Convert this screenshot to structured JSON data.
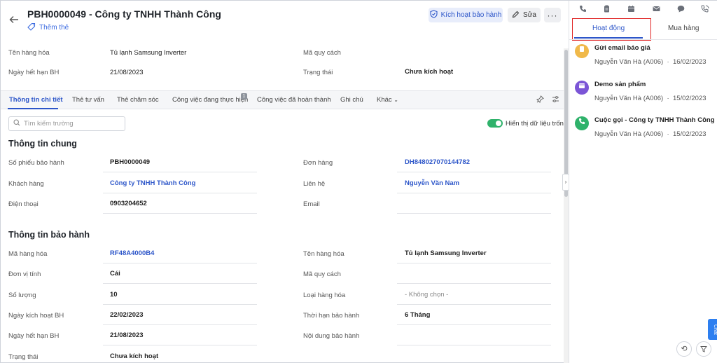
{
  "header": {
    "title": "PBH0000049 - Công ty TNHH Thành Công",
    "add_tag": "Thêm thẻ",
    "activate_btn": "Kích hoạt bảo hành",
    "edit_btn": "Sửa",
    "more_btn": "···"
  },
  "top_fields": {
    "product_name_label": "Tên hàng hóa",
    "product_name_value": "Tủ lạnh Samsung Inverter",
    "spec_label": "Mã quy cách",
    "expiry_label": "Ngày hết hạn BH",
    "expiry_value": "21/08/2023",
    "status_label": "Trạng thái",
    "status_value": "Chưa kích hoạt"
  },
  "tabs": [
    {
      "label": "Thông tin chi tiết"
    },
    {
      "label": "Thẻ tư vấn"
    },
    {
      "label": "Thẻ chăm sóc"
    },
    {
      "label": "Công việc đang thực hiện",
      "badge": "1"
    },
    {
      "label": "Công việc đã hoàn thành"
    },
    {
      "label": "Ghi chú"
    },
    {
      "label": "Khác"
    }
  ],
  "search": {
    "placeholder": "Tìm kiếm trường"
  },
  "toggle_label": "Hiển thị dữ liệu trống",
  "general": {
    "title": "Thông tin chung",
    "rows": [
      {
        "l1": "Số phiếu bảo hành",
        "v1": "PBH0000049",
        "l2": "Đơn hàng",
        "v2": "DH848027070144782"
      },
      {
        "l1": "Khách hàng",
        "v1": "Công ty TNHH Thành Công",
        "l2": "Liên hệ",
        "v2": "Nguyễn Văn Nam"
      },
      {
        "l1": "Điện thoại",
        "v1": "0903204652",
        "l2": "Email",
        "v2": ""
      }
    ]
  },
  "warranty": {
    "title": "Thông tin bảo hành",
    "rows": [
      {
        "l1": "Mã hàng hóa",
        "v1": "RF48A4000B4",
        "l2": "Tên hàng hóa",
        "v2": "Tủ lạnh Samsung Inverter"
      },
      {
        "l1": "Đơn vị tính",
        "v1": "Cái",
        "l2": "Mã quy cách",
        "v2": ""
      },
      {
        "l1": "Số lượng",
        "v1": "10",
        "l2": "Loại hàng hóa",
        "v2": "- Không chọn -"
      },
      {
        "l1": "Ngày kích hoạt BH",
        "v1": "22/02/2023",
        "l2": "Thời hạn bảo hành",
        "v2": "6 Tháng"
      },
      {
        "l1": "Ngày hết hạn BH",
        "v1": "21/08/2023",
        "l2": "Nội dung bảo hành",
        "v2": ""
      },
      {
        "l1": "Trạng thái",
        "v1": "Chưa kích hoạt",
        "l2": "",
        "v2": ""
      }
    ]
  },
  "side": {
    "tab_activity": "Hoạt động",
    "tab_purchase": "Mua hàng",
    "activities": [
      {
        "title": "Gửi email báo giá",
        "user": "Nguyễn Văn Hà (A006)",
        "date": "16/02/2023",
        "color": "#f0b94a",
        "icon": "email-quote-icon"
      },
      {
        "title": "Demo sản phẩm",
        "user": "Nguyễn Văn Hà (A006)",
        "date": "15/02/2023",
        "color": "#7b55d6",
        "icon": "calendar-icon"
      },
      {
        "title": "Cuộc gọi - Công ty TNHH Thành Công",
        "user": "Nguyễn Văn Hà (A006)",
        "date": "15/02/2023",
        "color": "#2fb26b",
        "icon": "phone-icon"
      }
    ],
    "chat": "Chat"
  }
}
